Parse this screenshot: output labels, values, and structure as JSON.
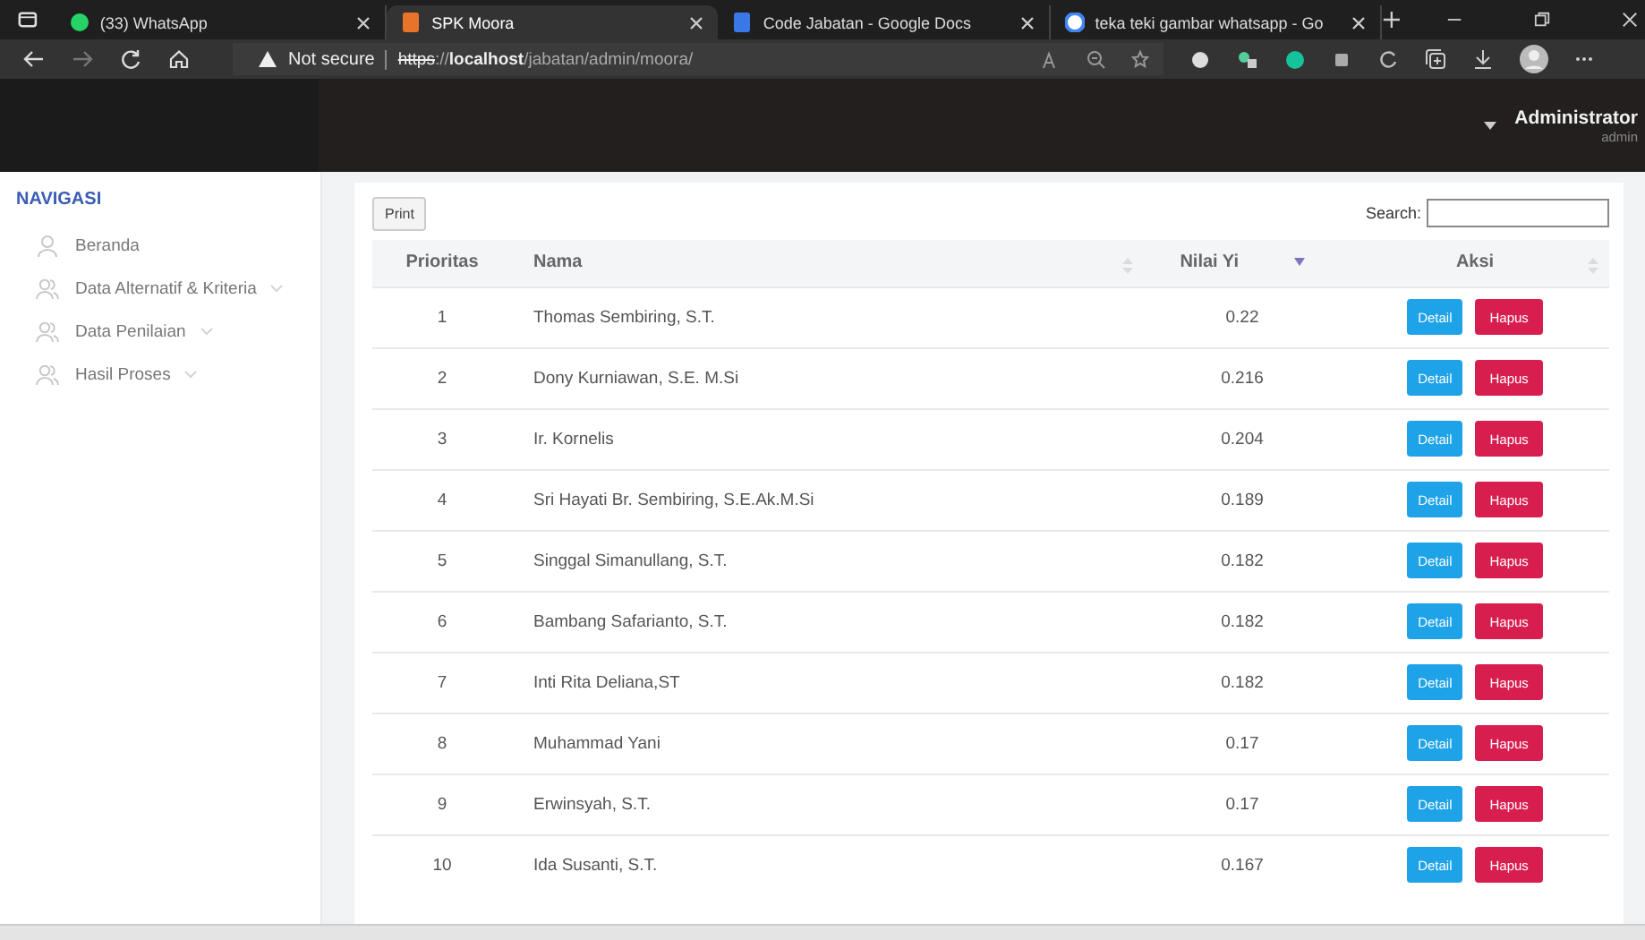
{
  "browser": {
    "tabs": [
      {
        "title": "(33) WhatsApp",
        "kind": "whatsapp",
        "selected": false
      },
      {
        "title": "SPK Moora",
        "kind": "app",
        "selected": true
      },
      {
        "title": "Code Jabatan - Google Docs",
        "kind": "docs",
        "selected": false
      },
      {
        "title": "teka teki gambar whatsapp - Go",
        "kind": "google",
        "selected": false
      }
    ],
    "security": "Not secure",
    "url": {
      "scheme": "https",
      "separator": "://",
      "host": "localhost",
      "path": "/jabatan/admin/moora/"
    }
  },
  "header": {
    "user": "Administrator",
    "role": "admin"
  },
  "sidebar": {
    "title": "NAVIGASI",
    "items": [
      {
        "label": "Beranda",
        "kind": "home",
        "has_submenu": false
      },
      {
        "label": "Data Alternatif & Kriteria",
        "kind": "group",
        "has_submenu": true
      },
      {
        "label": "Data Penilaian",
        "kind": "group",
        "has_submenu": true
      },
      {
        "label": "Hasil Proses",
        "kind": "group",
        "has_submenu": true
      }
    ]
  },
  "table": {
    "print": "Print",
    "search_label": "Search:",
    "columns": [
      {
        "label": "Prioritas",
        "sortable": false
      },
      {
        "label": "Nama",
        "sortable": true,
        "sorted_descending": false
      },
      {
        "label": "Nilai Yi",
        "sortable": true,
        "sorted_descending": true
      },
      {
        "label": "Aksi",
        "sortable": true,
        "sorted_descending": false
      }
    ],
    "rows": [
      {
        "rank": "1",
        "name": "Thomas Sembiring, S.T.",
        "value": "0.22",
        "actions": [
          "Detail",
          "Hapus"
        ]
      },
      {
        "rank": "2",
        "name": "Dony Kurniawan, S.E. M.Si",
        "value": "0.216",
        "actions": [
          "Detail",
          "Hapus"
        ]
      },
      {
        "rank": "3",
        "name": "Ir. Kornelis",
        "value": "0.204",
        "actions": [
          "Detail",
          "Hapus"
        ]
      },
      {
        "rank": "4",
        "name": "Sri Hayati Br. Sembiring, S.E.Ak.M.Si",
        "value": "0.189",
        "actions": [
          "Detail",
          "Hapus"
        ]
      },
      {
        "rank": "5",
        "name": "Singgal Simanullang, S.T.",
        "value": "0.182",
        "actions": [
          "Detail",
          "Hapus"
        ]
      },
      {
        "rank": "6",
        "name": "Bambang Safarianto, S.T.",
        "value": "0.182",
        "actions": [
          "Detail",
          "Hapus"
        ]
      },
      {
        "rank": "7",
        "name": "Inti Rita Deliana,ST",
        "value": "0.182",
        "actions": [
          "Detail",
          "Hapus"
        ]
      },
      {
        "rank": "8",
        "name": "Muhammad Yani",
        "value": "0.17",
        "actions": [
          "Detail",
          "Hapus"
        ]
      },
      {
        "rank": "9",
        "name": "Erwinsyah, S.T.",
        "value": "0.17",
        "actions": [
          "Detail",
          "Hapus"
        ]
      },
      {
        "rank": "10",
        "name": "Ida Susanti, S.T.",
        "value": "0.167",
        "actions": [
          "Detail",
          "Hapus"
        ]
      }
    ]
  }
}
